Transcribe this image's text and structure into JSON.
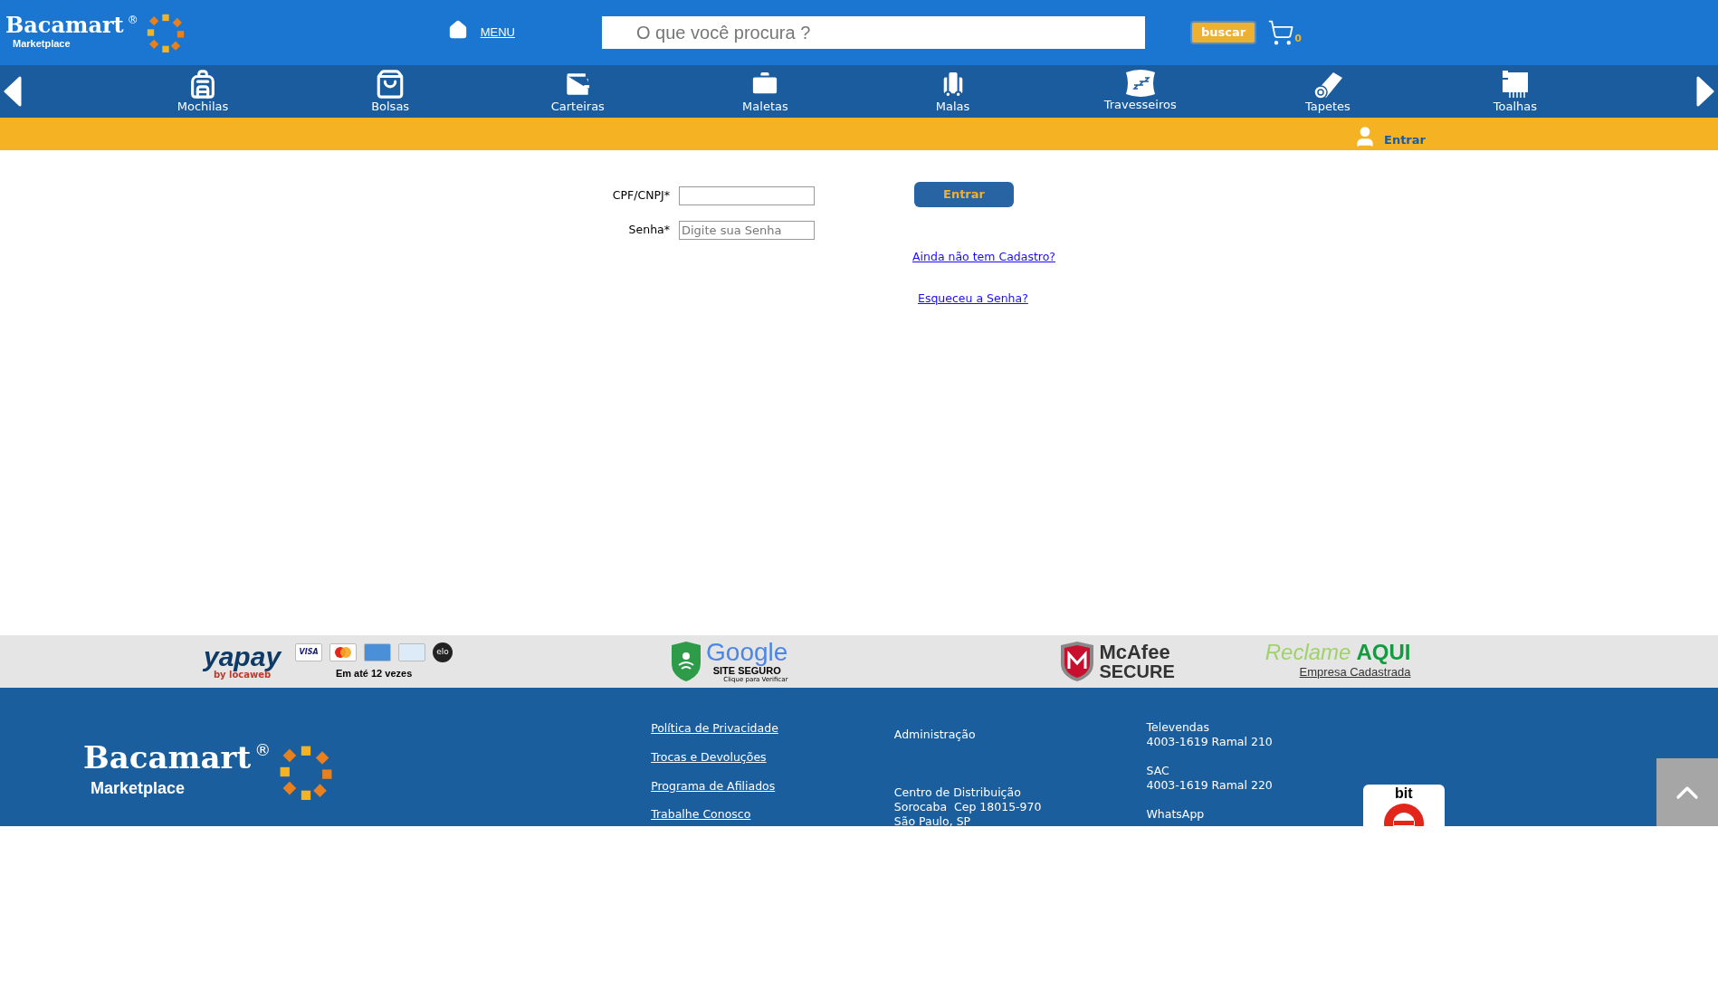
{
  "header": {
    "brand": "Bacamart",
    "registered": "®",
    "tagline": "Marketplace",
    "menu_link": "MENU",
    "search": {
      "placeholder": "O que você procura ?"
    },
    "search_button": "buscar",
    "cart_count": "0"
  },
  "categories": [
    {
      "label": "Mochilas",
      "kind": "backpack"
    },
    {
      "label": "Bolsas",
      "kind": "bag"
    },
    {
      "label": "Carteiras",
      "kind": "wallet"
    },
    {
      "label": "Maletas",
      "kind": "briefcase"
    },
    {
      "label": "Malas",
      "kind": "suitcase"
    },
    {
      "label": "Travesseiros",
      "kind": "pillow"
    },
    {
      "label": "Tapetes",
      "kind": "rug"
    },
    {
      "label": "Toalhas",
      "kind": "towel"
    }
  ],
  "user_bar": {
    "login_link": "Entrar"
  },
  "login_form": {
    "fields": [
      {
        "label": "CPF/CNPJ*"
      },
      {
        "label": "Senha*",
        "placeholder": "Digite sua Senha"
      }
    ],
    "submit": "Entrar",
    "links": [
      "Ainda não tem Cadastro?",
      "Esqueceu a Senha?"
    ]
  },
  "trust_bar": {
    "payment": {
      "brand": "yapay",
      "by": "by locaweb",
      "cards": [
        {
          "kind": "visa",
          "label": "VISA"
        },
        {
          "kind": "mastercard"
        },
        {
          "kind": "amex"
        },
        {
          "kind": "diners"
        },
        {
          "kind": "elo",
          "label": "elo"
        }
      ],
      "installments": "Em até 12 vezes"
    },
    "google": {
      "brand": "Google",
      "title": "SITE SEGURO",
      "hint": "Clique para Verificar"
    },
    "mcafee": {
      "brand": "McAfee",
      "title": "SECURE"
    },
    "reclame": {
      "word": "Reclame",
      "strong": "AQUI",
      "subtitle": "Empresa Cadastrada"
    }
  },
  "footer": {
    "brand": "Bacamart",
    "registered": "®",
    "tagline": "Marketplace",
    "links": [
      "Política de Privacidade",
      "Trocas e Devoluções",
      "Programa de Afiliados",
      "Trabalhe Conosco"
    ],
    "address": {
      "title": "Administração",
      "lines": [
        "Centro de Distribuição",
        "Sorocaba  Cep 18015-970",
        "São Paulo, SP"
      ]
    },
    "contacts": [
      {
        "label": "Televendas",
        "value": "4003-1619 Ramal 210"
      },
      {
        "label": "SAC",
        "value": "4003-1619 Ramal 220"
      },
      {
        "label": "WhatsApp"
      }
    ],
    "badge": "bit"
  }
}
